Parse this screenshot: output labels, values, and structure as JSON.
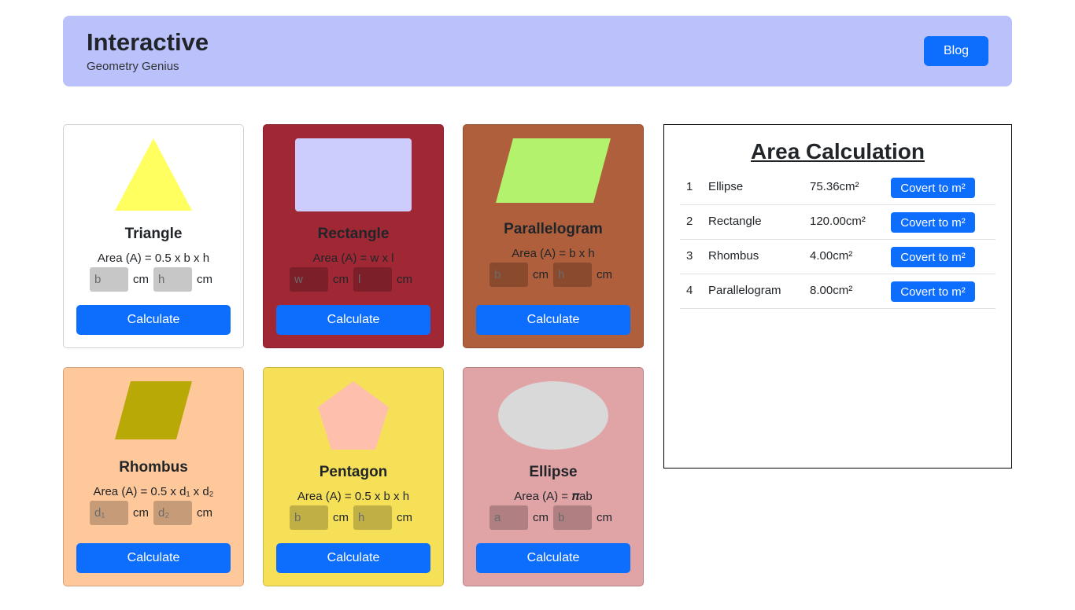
{
  "header": {
    "title": "Interactive",
    "subtitle": "Geometry Genius",
    "blog_label": "Blog"
  },
  "cards": [
    {
      "title": "Triangle",
      "formula": "Area (A) = 0.5 x b x h",
      "inputs": [
        "b",
        "h"
      ],
      "unit": "cm",
      "button": "Calculate",
      "bg": "#ffffff",
      "shape_color": "#ffff5f"
    },
    {
      "title": "Rectangle",
      "formula": "Area (A) = w x l",
      "inputs": [
        "w",
        "l"
      ],
      "unit": "cm",
      "button": "Calculate",
      "bg": "#a02834",
      "shape_color": "#cdcdfd"
    },
    {
      "title": "Parallelogram",
      "formula": "Area (A) = b x h",
      "inputs": [
        "b",
        "h"
      ],
      "unit": "cm",
      "button": "Calculate",
      "bg": "#b05f3c",
      "shape_color": "#b2f26c"
    },
    {
      "title": "Rhombus",
      "formula": "Area (A) = 0.5 x d₁ x d₂",
      "inputs": [
        "d₁",
        "d₂"
      ],
      "unit": "cm",
      "button": "Calculate",
      "bg": "#fec89a",
      "shape_color": "#b8a906"
    },
    {
      "title": "Pentagon",
      "formula": "Area (A) = 0.5 x b x h",
      "inputs": [
        "b",
        "h"
      ],
      "unit": "cm",
      "button": "Calculate",
      "bg": "#f6e058",
      "shape_color": "#febfad"
    },
    {
      "title": "Ellipse",
      "formula": "Area (A) = 𝝅ab",
      "inputs": [
        "a",
        "b"
      ],
      "unit": "cm",
      "button": "Calculate",
      "bg": "#e0a3a6",
      "shape_color": "#d9d9d9"
    }
  ],
  "panel": {
    "title": "Area Calculation",
    "rows": [
      {
        "index": "1",
        "name": "Ellipse",
        "area": "75.36cm²",
        "button": "Covert to m²"
      },
      {
        "index": "2",
        "name": "Rectangle",
        "area": "120.00cm²",
        "button": "Covert to m²"
      },
      {
        "index": "3",
        "name": "Rhombus",
        "area": "4.00cm²",
        "button": "Covert to m²"
      },
      {
        "index": "4",
        "name": "Parallelogram",
        "area": "8.00cm²",
        "button": "Covert to m²"
      }
    ]
  },
  "colors": {
    "accent": "#0d6efd",
    "header_bg": "#bac1fb"
  }
}
